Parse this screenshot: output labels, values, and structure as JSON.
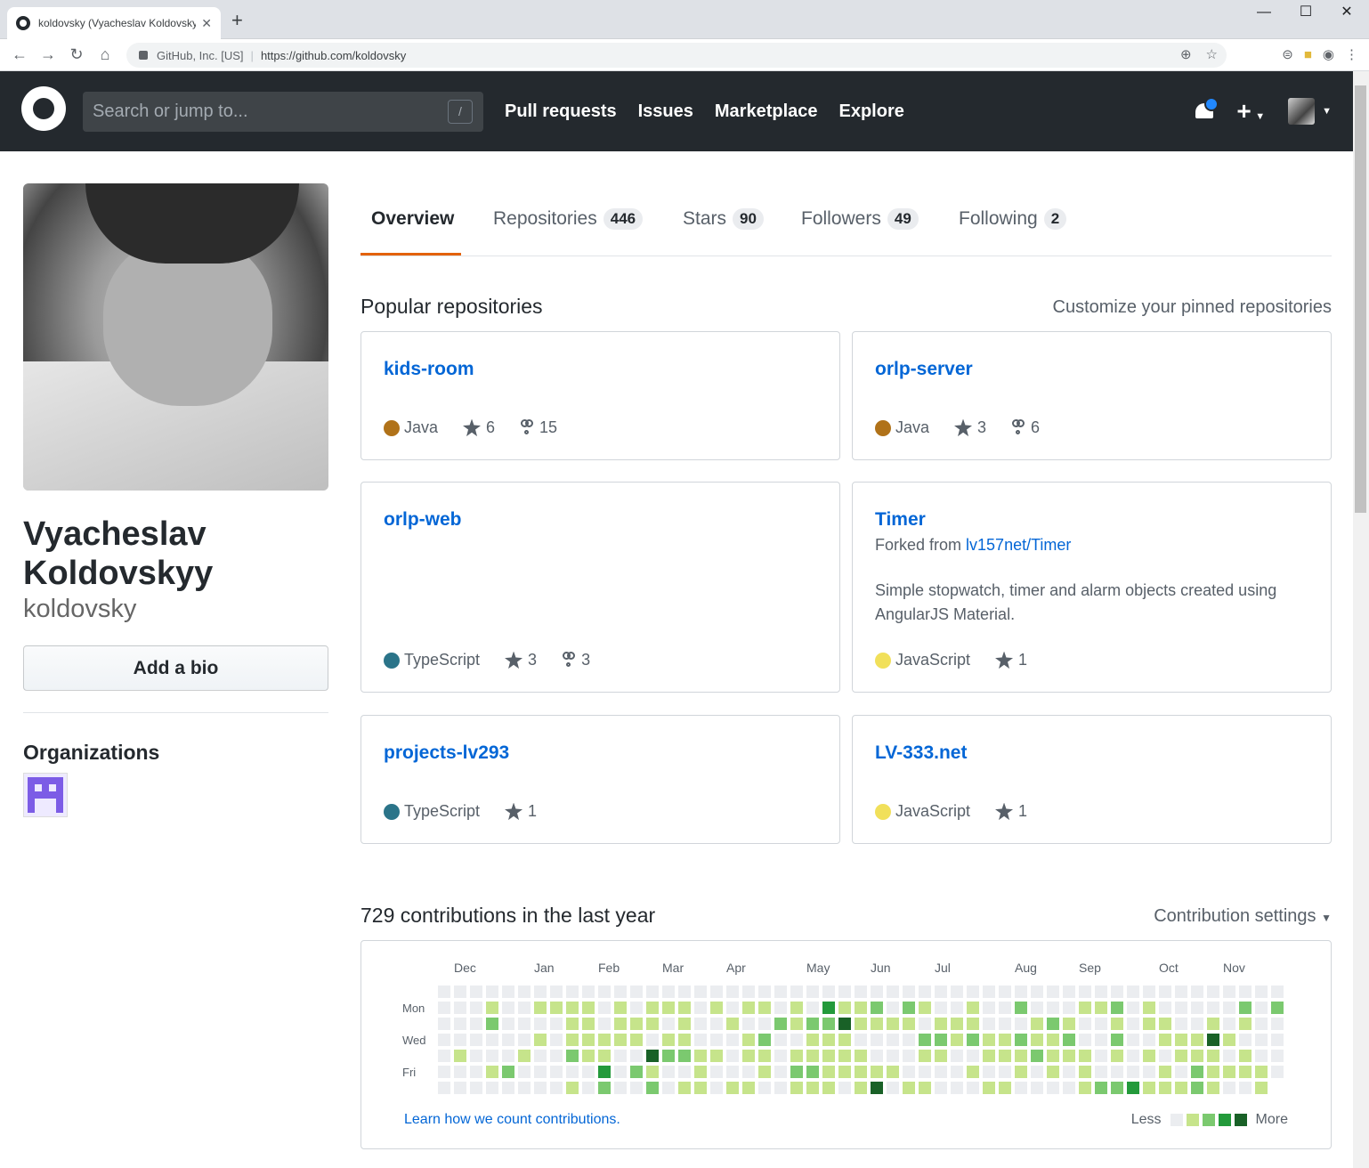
{
  "browser": {
    "tab_title": "koldovsky (Vyacheslav Koldovsky",
    "org": "GitHub, Inc. [US]",
    "url": "https://github.com/koldovsky"
  },
  "header": {
    "search_placeholder": "Search or jump to...",
    "search_shortcut": "/",
    "nav": [
      "Pull requests",
      "Issues",
      "Marketplace",
      "Explore"
    ]
  },
  "profile": {
    "name": "Vyacheslav Koldovskyy",
    "username": "koldovsky",
    "bio_button": "Add a bio",
    "organizations_title": "Organizations"
  },
  "tabs": [
    {
      "label": "Overview",
      "count": ""
    },
    {
      "label": "Repositories",
      "count": "446"
    },
    {
      "label": "Stars",
      "count": "90"
    },
    {
      "label": "Followers",
      "count": "49"
    },
    {
      "label": "Following",
      "count": "2"
    }
  ],
  "popular": {
    "title": "Popular repositories",
    "customize": "Customize your pinned repositories",
    "repos": [
      {
        "name": "kids-room",
        "lang": "Java",
        "color": "#b07219",
        "stars": "6",
        "forks": "15"
      },
      {
        "name": "orlp-server",
        "lang": "Java",
        "color": "#b07219",
        "stars": "3",
        "forks": "6"
      },
      {
        "name": "orlp-web",
        "lang": "TypeScript",
        "color": "#2b7489",
        "stars": "3",
        "forks": "3"
      },
      {
        "name": "Timer",
        "lang": "JavaScript",
        "color": "#f1e05a",
        "stars": "1",
        "forks": "",
        "fork_prefix": "Forked from ",
        "fork_link": "lv157net/Timer",
        "desc": "Simple stopwatch, timer and alarm objects created using AngularJS Material."
      },
      {
        "name": "projects-lv293",
        "lang": "TypeScript",
        "color": "#2b7489",
        "stars": "1",
        "forks": ""
      },
      {
        "name": "LV-333.net",
        "lang": "JavaScript",
        "color": "#f1e05a",
        "stars": "1",
        "forks": ""
      }
    ]
  },
  "contributions": {
    "title": "729 contributions in the last year",
    "settings": "Contribution settings",
    "months": [
      "Dec",
      "Jan",
      "Feb",
      "Mar",
      "Apr",
      "May",
      "Jun",
      "Jul",
      "Aug",
      "Sep",
      "Oct",
      "Nov"
    ],
    "days": [
      "Mon",
      "Wed",
      "Fri"
    ],
    "learn": "Learn how we count contributions.",
    "less": "Less",
    "more": "More",
    "colors": [
      "#ebedf0",
      "#c6e48b",
      "#7bc96f",
      "#239a3b",
      "#196127"
    ]
  }
}
